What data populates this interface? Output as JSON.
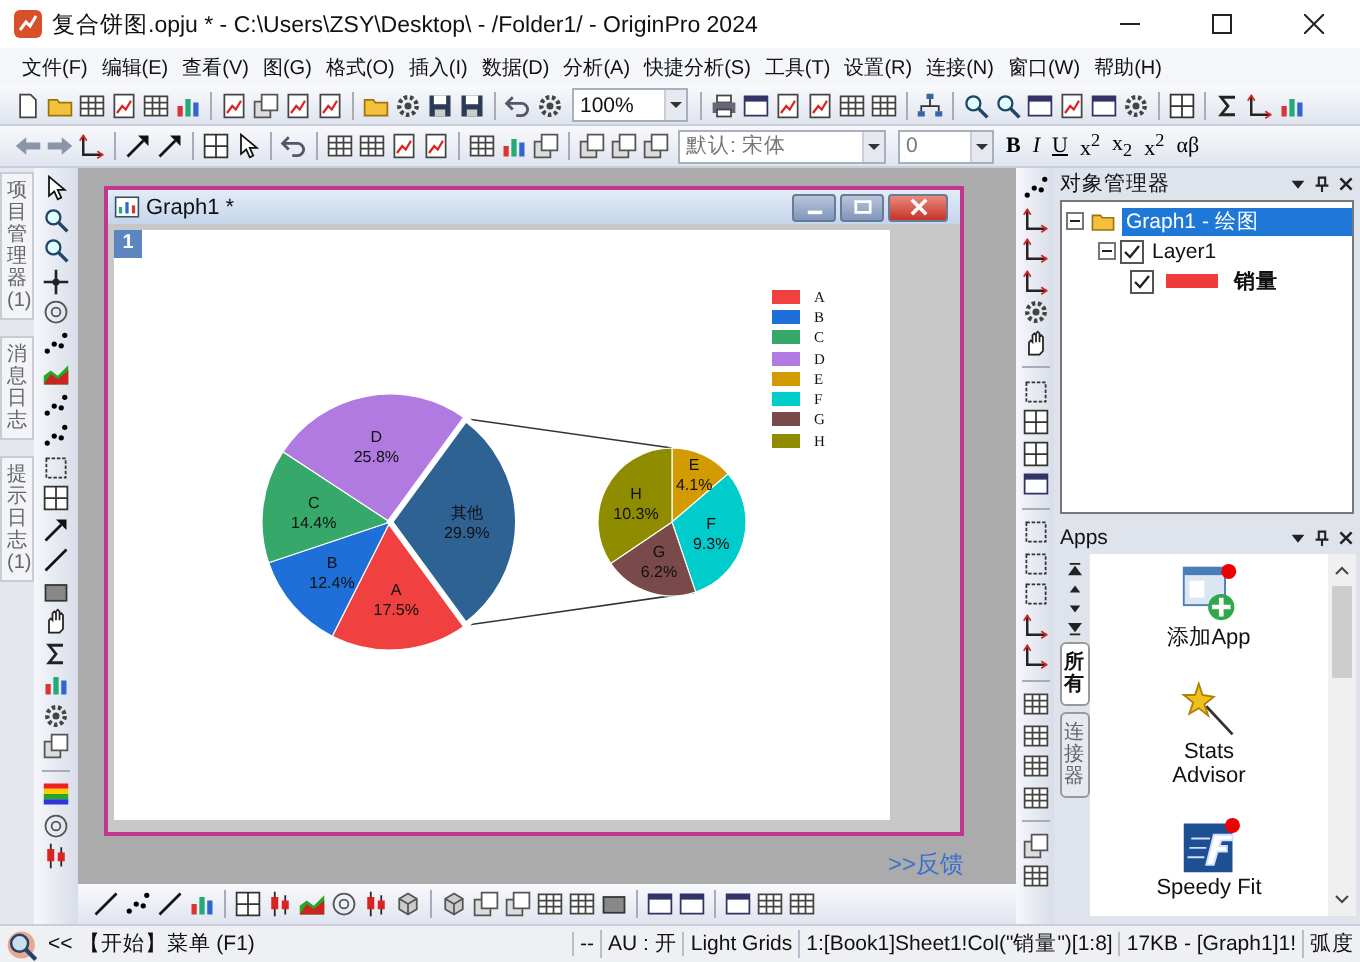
{
  "window": {
    "title": "复合饼图.opju * - C:\\Users\\ZSY\\Desktop\\ - /Folder1/ - OriginPro 2024"
  },
  "menu": [
    "文件(F)",
    "编辑(E)",
    "查看(V)",
    "图(G)",
    "格式(O)",
    "插入(I)",
    "数据(D)",
    "分析(A)",
    "快捷分析(S)",
    "工具(T)",
    "设置(R)",
    "连接(N)",
    "窗口(W)",
    "帮助(H)"
  ],
  "toolbar": {
    "zoom": "100%",
    "font": "默认: 宋体",
    "font_size": "0",
    "format_buttons": [
      "B",
      "I",
      "U",
      "x$^{2}$",
      "x$_{2}$",
      "x$^{2}$",
      "αβ"
    ]
  },
  "side_tabs": [
    {
      "label": "项目管理器 (1)"
    },
    {
      "label": "消息日志"
    },
    {
      "label": "提示日志 (1)"
    }
  ],
  "graph_window": {
    "title": "Graph1 *",
    "layer": "1",
    "legend": [
      {
        "label": "A",
        "color": "#f04040"
      },
      {
        "label": "B",
        "color": "#1f6fd8"
      },
      {
        "label": "C",
        "color": "#35a86a"
      },
      {
        "label": "D",
        "color": "#b07ae0"
      },
      {
        "label": "E",
        "color": "#d29b00"
      },
      {
        "label": "F",
        "color": "#00cccc"
      },
      {
        "label": "G",
        "color": "#7a4a4a"
      },
      {
        "label": "H",
        "color": "#8f8c00"
      }
    ],
    "other_slice": {
      "color": "#2e6292"
    },
    "main_pie": {
      "chart_data": {
        "type": "pie",
        "categories": [
          "A",
          "B",
          "C",
          "D",
          "其他"
        ],
        "values": [
          17.5,
          12.4,
          14.4,
          25.8,
          29.9
        ],
        "value_labels": [
          "17.5%",
          "12.4%",
          "14.4%",
          "25.8%",
          "29.9%"
        ]
      }
    },
    "sub_pie": {
      "chart_data": {
        "type": "pie",
        "categories": [
          "E",
          "F",
          "G",
          "H"
        ],
        "values": [
          4.1,
          9.3,
          6.2,
          10.3
        ],
        "value_labels": [
          "4.1%",
          "9.3%",
          "6.2%",
          "10.3%"
        ]
      }
    }
  },
  "feedback_link": ">>反馈",
  "object_manager": {
    "title": "对象管理器",
    "tree": [
      {
        "label": "Graph1 - 绘图",
        "selected": true,
        "expanded": true,
        "children": [
          {
            "label": "Layer1",
            "checked": true,
            "expanded": true,
            "children": [
              {
                "label": "销量",
                "checked": true,
                "color": "#ee3b3b"
              }
            ]
          }
        ]
      }
    ]
  },
  "apps": {
    "title": "Apps",
    "tabs": [
      {
        "label": "所有",
        "selected": true
      },
      {
        "label": "连接器",
        "selected": false
      }
    ],
    "items": [
      {
        "label": "添加App",
        "kind": "add"
      },
      {
        "label": "Stats Advisor",
        "kind": "wand"
      },
      {
        "label": "Speedy Fit",
        "kind": "fit"
      }
    ]
  },
  "status_bar": {
    "nav": "<<",
    "message": "【开始】菜单 (F1)",
    "cells": [
      "--",
      "AU : 开",
      "Light Grids",
      "1:[Book1]Sheet1!Col(\"销量\")[1:8]",
      "17KB - [Graph1]1!",
      "弧度"
    ]
  }
}
